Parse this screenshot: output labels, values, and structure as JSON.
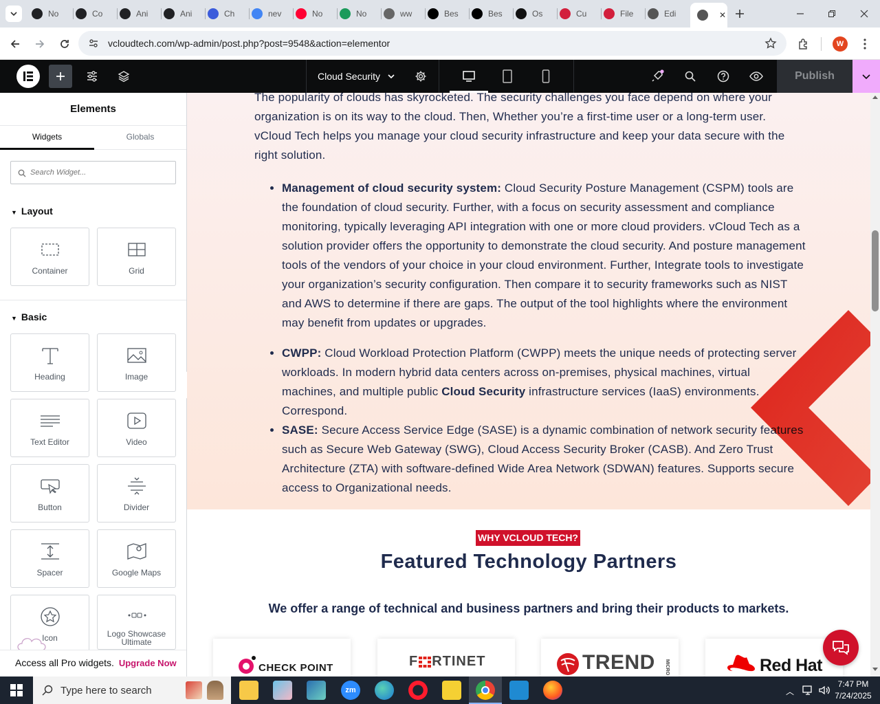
{
  "browser": {
    "tabs": [
      {
        "label": "No",
        "icon": "notion-icon",
        "color": "#202124"
      },
      {
        "label": "Co",
        "icon": "chatgpt-icon",
        "color": "#202124"
      },
      {
        "label": "Ani",
        "icon": "chatgpt-icon",
        "color": "#202124"
      },
      {
        "label": "Ani",
        "icon": "chatgpt-icon",
        "color": "#202124"
      },
      {
        "label": "Ch",
        "icon": "copilot-icon",
        "color": "#3b5bdb"
      },
      {
        "label": "nev",
        "icon": "google-icon",
        "color": "#4285f4"
      },
      {
        "label": "No",
        "icon": "youtube-icon",
        "color": "#ff0033"
      },
      {
        "label": "No",
        "icon": "w-icon",
        "color": "#1a9a5a"
      },
      {
        "label": "ww",
        "icon": "linkedin-icon",
        "color": "#666"
      },
      {
        "label": "Bes",
        "icon": "x-icon",
        "color": "#000"
      },
      {
        "label": "Bes",
        "icon": "x-icon",
        "color": "#000"
      },
      {
        "label": "Os",
        "icon": "ai-icon",
        "color": "#111"
      },
      {
        "label": "Cu",
        "icon": "elementor-kit-icon",
        "color": "#d21f3c"
      },
      {
        "label": "File",
        "icon": "elementor-kit-icon",
        "color": "#d21f3c"
      },
      {
        "label": "Edi",
        "icon": "wordpress-icon",
        "color": "#555"
      },
      {
        "label": "",
        "icon": "wordpress-icon",
        "color": "#555",
        "active": true
      }
    ],
    "url": "vcloudtech.com/wp-admin/post.php?post=9548&action=elementor",
    "profile_initial": "W"
  },
  "editor": {
    "page_name": "Cloud Security",
    "publish_label": "Publish"
  },
  "sidebar": {
    "title": "Elements",
    "tabs": [
      "Widgets",
      "Globals"
    ],
    "search_placeholder": "Search Widget...",
    "layout_title": "Layout",
    "basic_title": "Basic",
    "layout_widgets": [
      "Container",
      "Grid"
    ],
    "basic_widgets": [
      "Heading",
      "Image",
      "Text Editor",
      "Video",
      "Button",
      "Divider",
      "Spacer",
      "Google Maps",
      "Icon",
      "Logo Showcase Ultimate"
    ],
    "promo_text": "Access all Pro widgets.",
    "promo_link": "Upgrade Now"
  },
  "content": {
    "intro": "The popularity of clouds has skyrocketed. The security challenges you face depend on where your organization is on its way to the cloud. Then, Whether you’re a first-time user or a long-term user. vCloud Tech helps you manage your cloud security infrastructure and keep your data secure with the right solution.",
    "bullets": [
      {
        "bold": "Management of cloud security system:",
        "text": " Cloud Security Posture Management (CSPM) tools are the foundation of cloud security. Further, with a focus on security assessment and compliance monitoring, typically leveraging API integration with one or more cloud providers. vCloud Tech as a solution provider  offers the opportunity to demonstrate the cloud security. And posture management tools of the vendors of your choice in your cloud environment. Further, Integrate tools to investigate your organization’s security configuration. Then compare it to security frameworks such as NIST and AWS to determine if there are gaps. The output of the tool highlights where the environment may benefit from updates or upgrades."
      },
      {
        "bold": "CWPP:",
        "text_before": "  Cloud Workload Protection Platform (CWPP) meets the unique needs of protecting server workloads. In modern hybrid data centers across on-premises, physical machines, virtual machines, and multiple public ",
        "inline_bold": "Cloud Security",
        "text_after": " infrastructure services (IaaS) environments. Correspond."
      },
      {
        "bold": "SASE:",
        "text": " Secure Access Service Edge (SASE) is a dynamic combination of network security features such as Secure Web Gateway (SWG), Cloud Access Security Broker (CASB).  And Zero Trust Architecture (ZTA) with software-defined Wide Area Network (SDWAN) features. Supports secure access to Organizational needs."
      }
    ],
    "badge": "WHY VCLOUD TECH?",
    "heading": "Featured Technology Partners",
    "subheading": "We offer a range of technical and business partners and bring their products to markets.",
    "partners": [
      "CHECK POINT",
      "F",
      "RTINET",
      "TREND",
      "MICRO",
      "Red Hat"
    ],
    "brand_color": "#d0112b"
  },
  "taskbar": {
    "search_placeholder": "Type here to search",
    "time": "7:47 PM",
    "date": "7/24/2025"
  }
}
